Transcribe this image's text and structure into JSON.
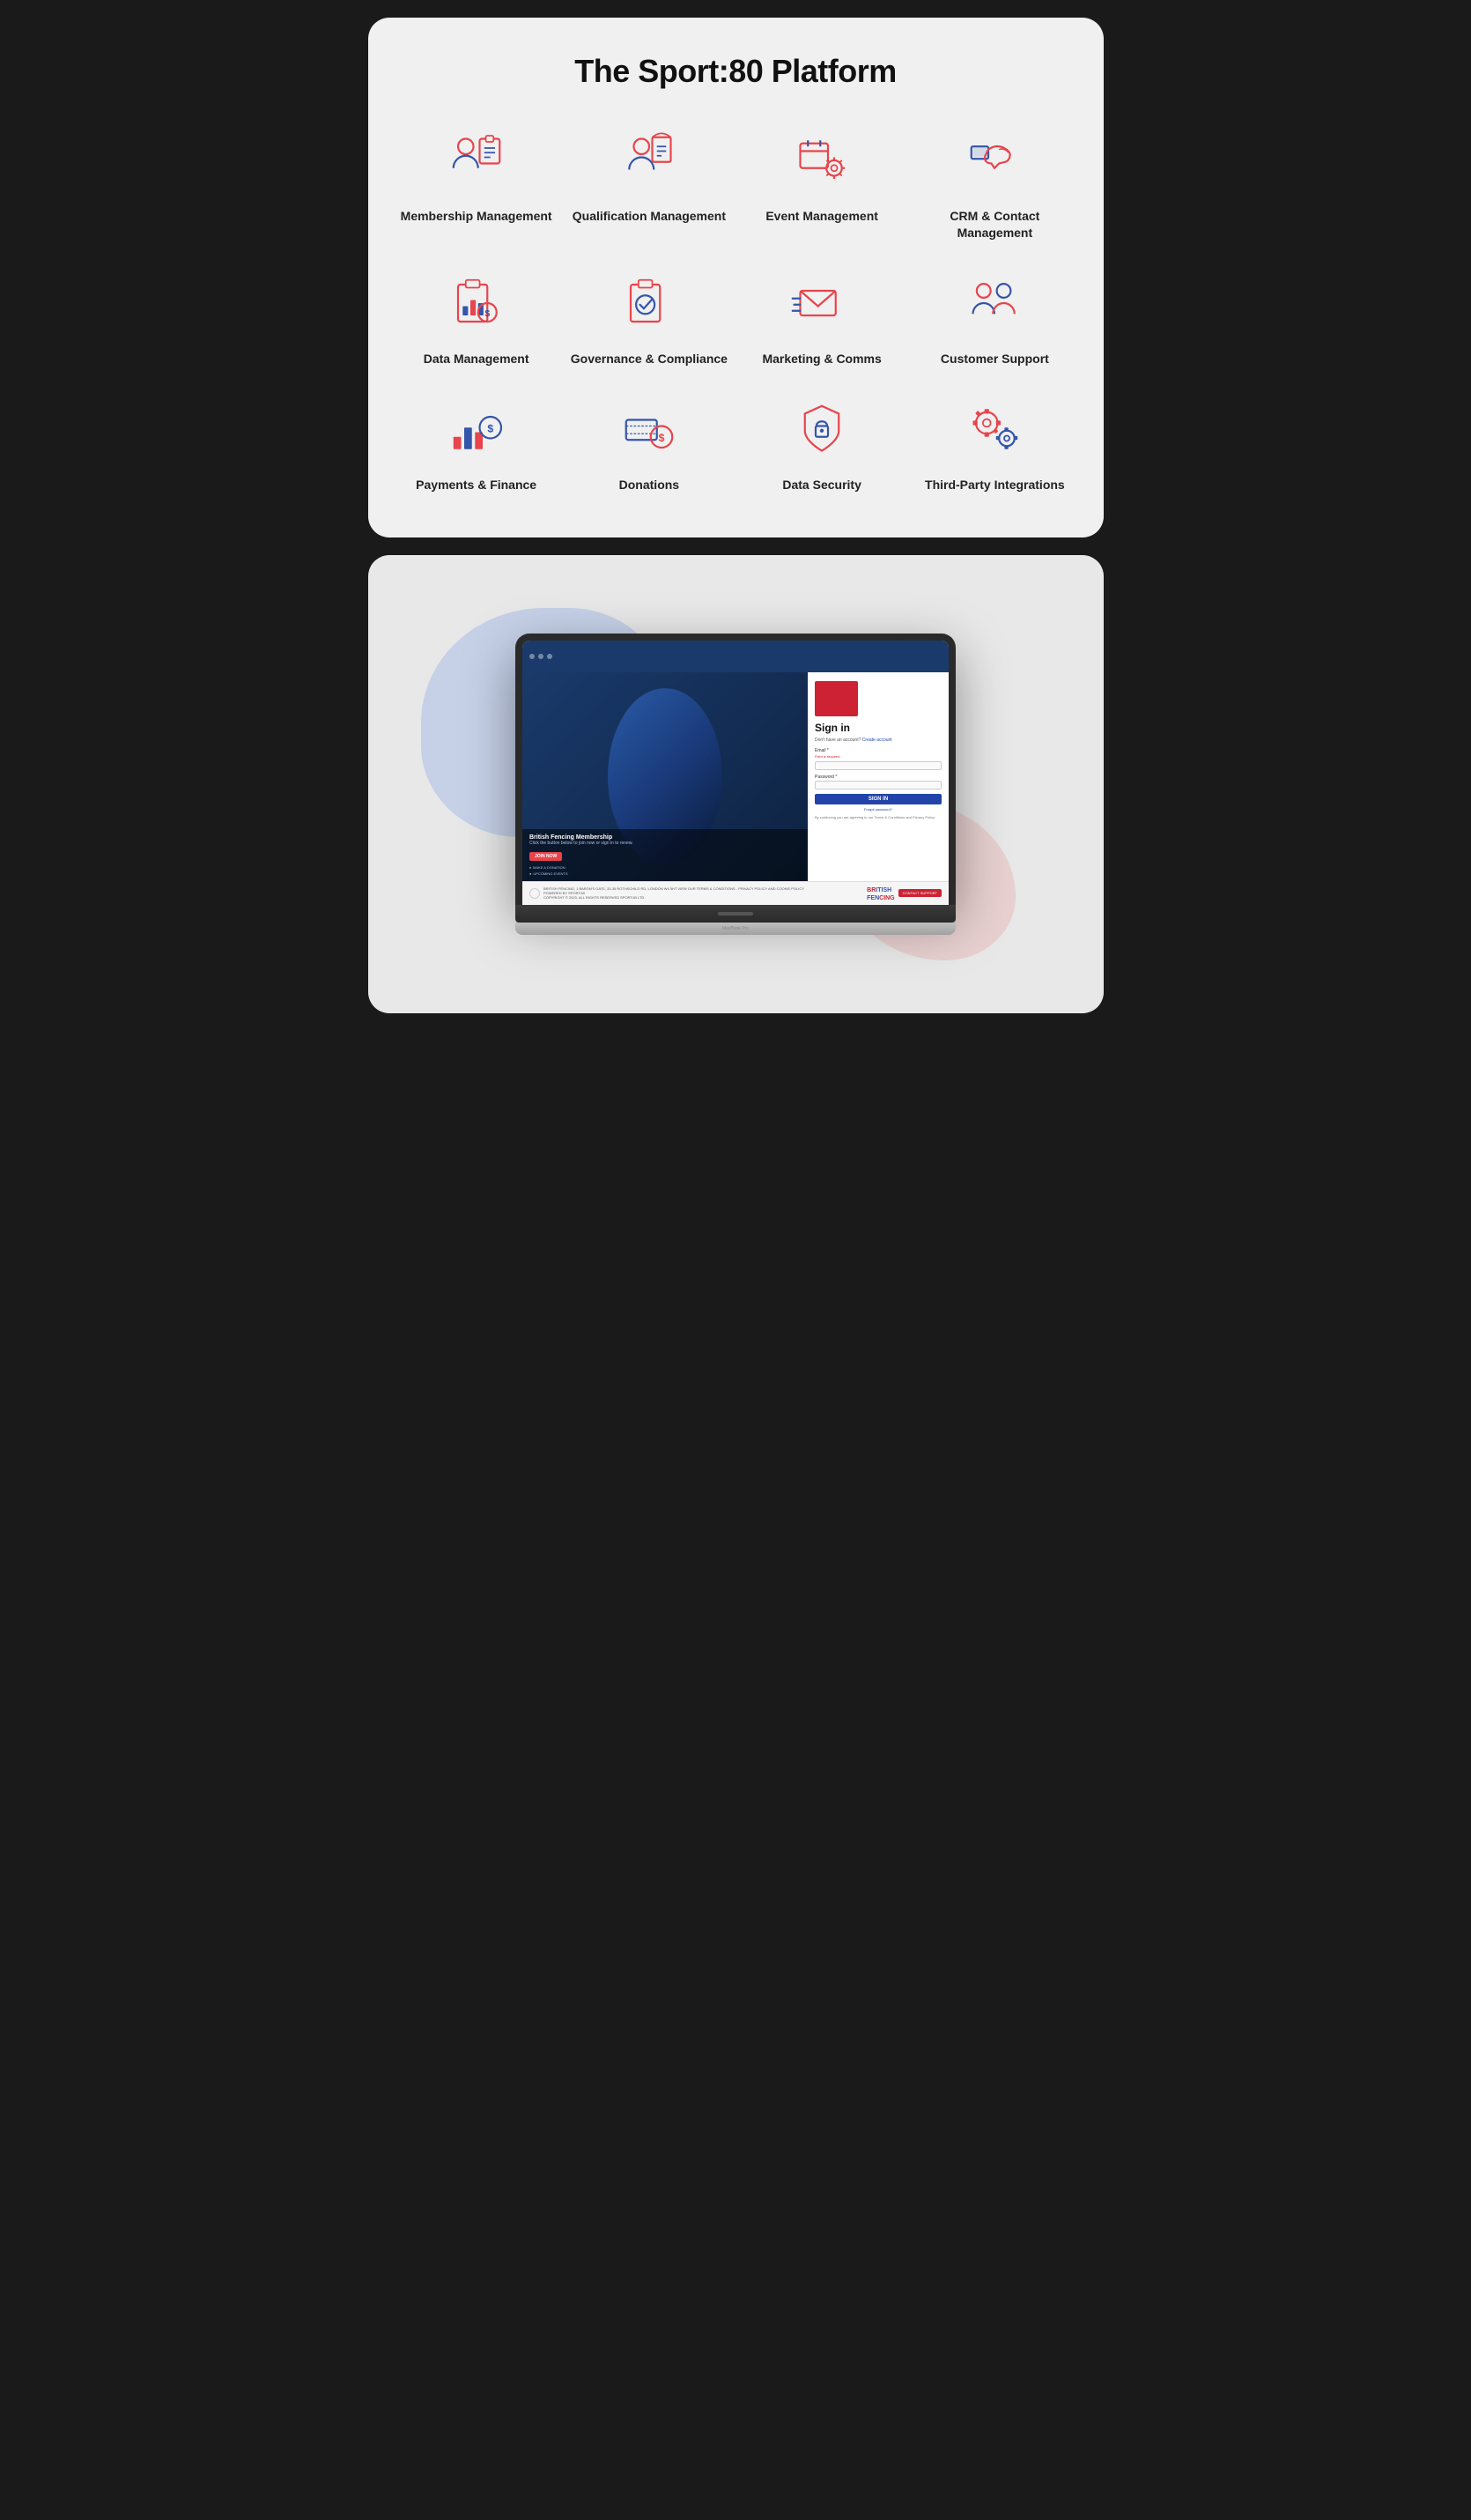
{
  "page": {
    "background": "#1a1a1a"
  },
  "topCard": {
    "title": "The Sport:80 Platform",
    "features": [
      {
        "id": "membership-management",
        "label": "Membership Management",
        "icon": "membership-icon"
      },
      {
        "id": "qualification-management",
        "label": "Qualification Management",
        "icon": "qualification-icon"
      },
      {
        "id": "event-management",
        "label": "Event Management",
        "icon": "event-icon"
      },
      {
        "id": "crm-contact",
        "label": "CRM & Contact Management",
        "icon": "crm-icon"
      },
      {
        "id": "data-management",
        "label": "Data Management",
        "icon": "data-mgmt-icon"
      },
      {
        "id": "governance-compliance",
        "label": "Governance & Compliance",
        "icon": "governance-icon"
      },
      {
        "id": "marketing-comms",
        "label": "Marketing & Comms",
        "icon": "marketing-icon"
      },
      {
        "id": "customer-support",
        "label": "Customer Support",
        "icon": "support-icon"
      },
      {
        "id": "payments-finance",
        "label": "Payments & Finance",
        "icon": "payments-icon"
      },
      {
        "id": "donations",
        "label": "Donations",
        "icon": "donations-icon"
      },
      {
        "id": "data-security",
        "label": "Data Security",
        "icon": "security-icon"
      },
      {
        "id": "third-party",
        "label": "Third-Party Integrations",
        "icon": "integrations-icon"
      }
    ]
  },
  "bottomCard": {
    "laptop": {
      "brand": "MacBook Pro",
      "website": {
        "title": "British Fencing Membership",
        "subtitle": "Click the button below to join now or sign in to renew.",
        "joinBtn": "JOIN NOW",
        "signInTitle": "Sign in",
        "signInSub": "Don't have an account?",
        "createAccount": "Create account",
        "emailLabel": "Email *",
        "emailError": "Field is required",
        "passwordLabel": "Password *",
        "signInBtn": "SIGN IN",
        "forgotPassword": "Forgot password?",
        "termsText": "By continuing you are agreeing to our Terms & Conditions and Privacy Policy",
        "donationLink": "MAKE A DONATION",
        "eventsLink": "UPCOMING EVENTS",
        "footerAddress": "BRITISH FENCING, 1 BARON'S GATE, 33-35 ROTHSCHILD RD, LONDON W4 5HT VIEW OUR TERMS & CONDITIONS - PRIVACY POLICY AND COOKIE POLICY",
        "poweredBy": "POWERED BY SPORT:80",
        "copyright": "COPYRIGHT © 2023, ALL RIGHTS RESERVED SPORT:80 LTD.",
        "contactSupport": "CONTACT SUPPORT",
        "brandName": "BRITISH FENCING"
      }
    }
  }
}
